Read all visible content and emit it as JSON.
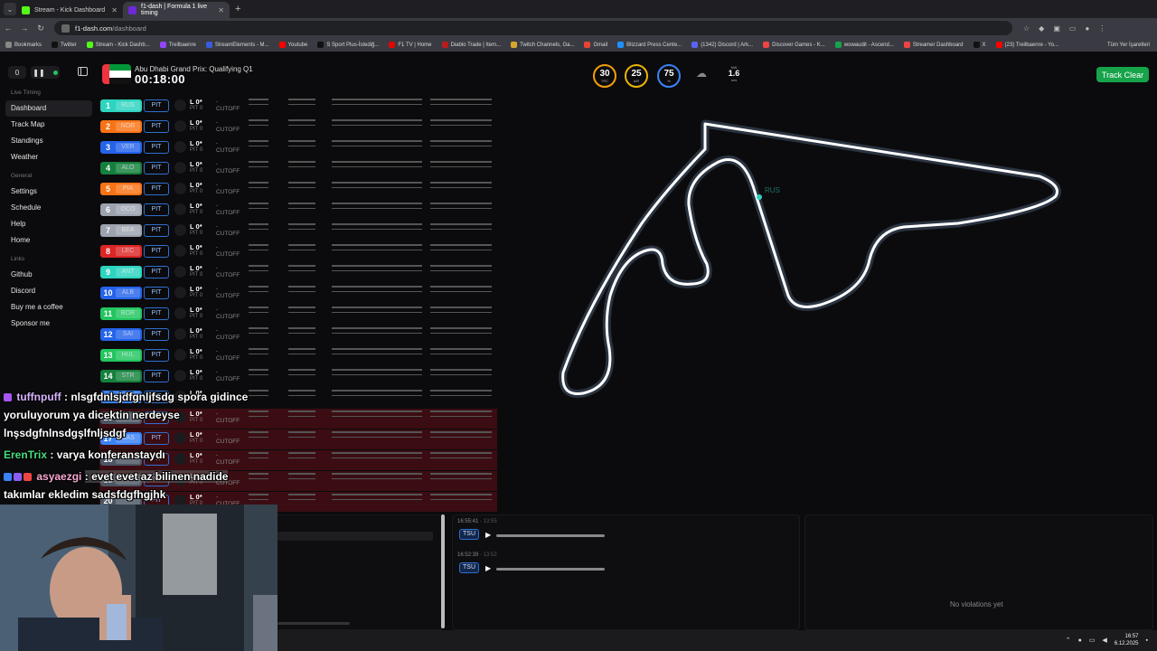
{
  "browser": {
    "tabs": [
      {
        "title": "Stream - Kick Dashboard",
        "color": "#53fc18",
        "active": false
      },
      {
        "title": "f1-dash | Formula 1 live timing",
        "color": "#6d28d9",
        "active": true
      }
    ],
    "url_host": "f1-dash.com",
    "url_path": "/dashboard",
    "bookmarks": [
      {
        "label": "Bookmarks",
        "color": "#888"
      },
      {
        "label": "Twitter",
        "color": "#111"
      },
      {
        "label": "Stream - Kick Dashb...",
        "color": "#53fc18"
      },
      {
        "label": "Treilbaenre",
        "color": "#9146ff"
      },
      {
        "label": "StreamElements - M...",
        "color": "#3b5bdb"
      },
      {
        "label": "Youtube",
        "color": "#ff0000"
      },
      {
        "label": "S Sport Plus-İstediğ...",
        "color": "#111"
      },
      {
        "label": "F1 TV | Home",
        "color": "#e10600"
      },
      {
        "label": "Diablo Trade | Item...",
        "color": "#b91c1c"
      },
      {
        "label": "Twitch Channels, Ga...",
        "color": "#d4a72c"
      },
      {
        "label": "Gmail",
        "color": "#ea4335"
      },
      {
        "label": "Blizzard Press Cente...",
        "color": "#1e90ff"
      },
      {
        "label": "(1342) Discord | Ark...",
        "color": "#5865f2"
      },
      {
        "label": "Discover Games - K...",
        "color": "#ef4444"
      },
      {
        "label": "wowaudit - Ascend...",
        "color": "#16a34a"
      },
      {
        "label": "Streamer Dashboard",
        "color": "#ef4444"
      },
      {
        "label": "X",
        "color": "#111"
      },
      {
        "label": "(23) Treilbaenre - Yo...",
        "color": "#ff0000"
      }
    ],
    "all_bookmarks": "Tüm Yer İşaretleri"
  },
  "header": {
    "counter": "0",
    "session_title": "Abu Dhabi Grand Prix: Qualifying Q1",
    "session_clock": "00:18:00",
    "weather": [
      {
        "value": "30",
        "unit": "TRC",
        "color": "#f59e0b"
      },
      {
        "value": "25",
        "unit": "AIR",
        "color": "#eab308"
      },
      {
        "value": "75",
        "unit": "%",
        "color": "#3b82f6"
      }
    ],
    "wind_label": "NW",
    "wind_value": "1.6",
    "wind_unit": "m/s",
    "track_status": "Track Clear",
    "track_status_color": "#16a34a"
  },
  "sidebar": {
    "sections": [
      {
        "title": "Live Timing",
        "items": [
          "Dashboard",
          "Track Map",
          "Standings",
          "Weather"
        ]
      },
      {
        "title": "General",
        "items": [
          "Settings",
          "Schedule",
          "Help",
          "Home"
        ]
      },
      {
        "title": "Links",
        "items": [
          "Github",
          "Discord",
          "Buy me a coffee",
          "Sponsor me"
        ]
      }
    ],
    "active": "Dashboard"
  },
  "drivers": [
    {
      "pos": "1",
      "tla": "RUS",
      "color": "#2dd4bf"
    },
    {
      "pos": "2",
      "tla": "NOR",
      "color": "#f97316"
    },
    {
      "pos": "3",
      "tla": "VER",
      "color": "#2563eb"
    },
    {
      "pos": "4",
      "tla": "ALO",
      "color": "#15803d"
    },
    {
      "pos": "5",
      "tla": "PIA",
      "color": "#f97316"
    },
    {
      "pos": "6",
      "tla": "OCO",
      "color": "#9ca3af"
    },
    {
      "pos": "7",
      "tla": "BEA",
      "color": "#9ca3af"
    },
    {
      "pos": "8",
      "tla": "LEC",
      "color": "#dc2626"
    },
    {
      "pos": "9",
      "tla": "ANT",
      "color": "#2dd4bf"
    },
    {
      "pos": "10",
      "tla": "ALB",
      "color": "#2563eb"
    },
    {
      "pos": "11",
      "tla": "BOR",
      "color": "#22c55e"
    },
    {
      "pos": "12",
      "tla": "SAI",
      "color": "#2563eb"
    },
    {
      "pos": "13",
      "tla": "HUL",
      "color": "#22c55e"
    },
    {
      "pos": "14",
      "tla": "STR",
      "color": "#15803d"
    },
    {
      "pos": "15",
      "tla": "",
      "color": "#3b82f6"
    },
    {
      "pos": "16",
      "tla": "",
      "color": "#4b5563"
    },
    {
      "pos": "17",
      "tla": "GAS",
      "color": "#3b82f6"
    },
    {
      "pos": "18",
      "tla": "",
      "color": "#4b5563"
    },
    {
      "pos": "19",
      "tla": "",
      "color": "#4b5563"
    },
    {
      "pos": "20",
      "tla": "",
      "color": "#4b5563"
    }
  ],
  "row_labels": {
    "lap": "L 0*",
    "pit": "PIT 0",
    "gap": "-",
    "cutoff": "CUTOFF",
    "pit_button": "PIT"
  },
  "track_map": {
    "marker": "RUS"
  },
  "radio": [
    {
      "time": "16:55:41",
      "ago": "13:55",
      "driver": "TSU"
    },
    {
      "time": "16:52:39",
      "ago": "13:52",
      "driver": "TSU"
    }
  ],
  "violations": {
    "empty": "No violations yet"
  },
  "chat": [
    {
      "user": "tuffnpuff",
      "text": ": nlsgfdnlsjdfgnljfsdg spora gidince",
      "color": "#d8b4fe"
    },
    {
      "user": "",
      "text": "yoruluyorum ya dicektin nerdeyse",
      "color": ""
    },
    {
      "user": "",
      "text": "lnşsdgfnlnsdgşlfnljsdgf",
      "color": ""
    },
    {
      "user": "ErenTrix",
      "text": ": varya konferanstaydı",
      "color": "#4ade80"
    },
    {
      "user": "asyaezgi",
      "text": ": evet evet az bilinen nadide",
      "color": "#f9a8d4"
    },
    {
      "user": "",
      "text": "takımlar ekledim sadsfdgfhgjhk",
      "color": ""
    }
  ],
  "taskbar": {
    "time": "16:57",
    "date": "6.12.2025"
  }
}
